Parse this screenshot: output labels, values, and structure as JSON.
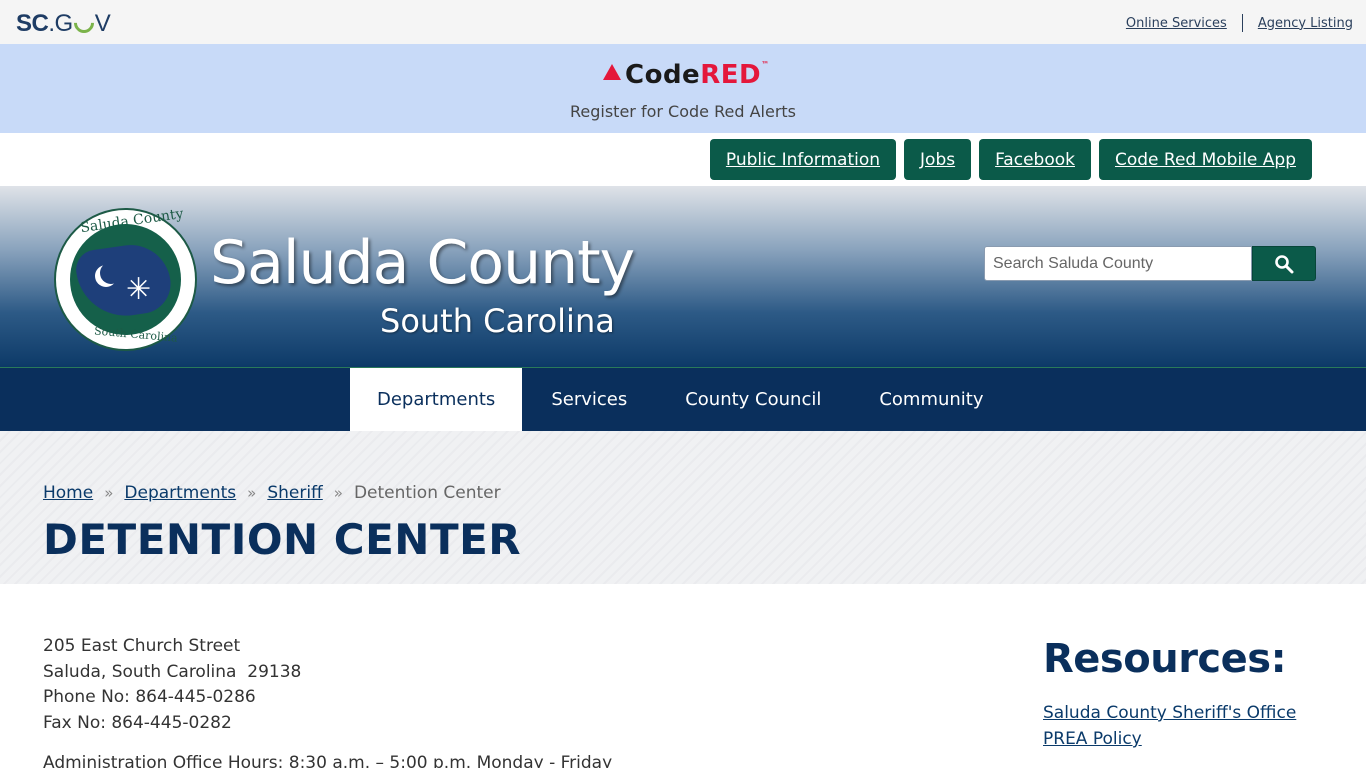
{
  "topbar": {
    "brand_sc": "SC",
    "brand_dot": ".",
    "brand_g": "G",
    "brand_v": "V",
    "links": [
      "Online Services",
      "Agency Listing"
    ]
  },
  "codered": {
    "logo_code": "Code",
    "logo_red": "RED",
    "logo_tm": "™",
    "text": "Register for Code Red Alerts"
  },
  "quick_links": [
    "Public Information",
    "Jobs",
    "Facebook",
    "Code Red Mobile App"
  ],
  "header": {
    "seal_top": "Saluda County",
    "seal_bottom": "South Carolina",
    "title": "Saluda County",
    "subtitle": "South Carolina",
    "search_placeholder": "Search Saluda County"
  },
  "nav": {
    "items": [
      "Departments",
      "Services",
      "County Council",
      "Community"
    ],
    "active": "Departments"
  },
  "breadcrumb": {
    "items": [
      "Home",
      "Departments",
      "Sheriff"
    ],
    "separator": "»",
    "current": "Detention Center"
  },
  "page_title": "DETENTION CENTER",
  "address": {
    "street": "205 East Church Street",
    "city": "Saluda, South Carolina  29138",
    "phone": "Phone No: 864-445-0286",
    "fax": "Fax No: 864-445-0282",
    "hours": "Administration Office Hours: 8:30 a.m. – 5:00 p.m. Monday - Friday"
  },
  "resources": {
    "title": "Resources:",
    "links": [
      "Saluda County Sheriff's Office",
      "PREA Policy "
    ]
  },
  "colors": {
    "accent_green": "#0b5a49",
    "navy": "#0a2f5c",
    "codered_red": "#e4173b",
    "codered_bg": "#c8daf8"
  }
}
